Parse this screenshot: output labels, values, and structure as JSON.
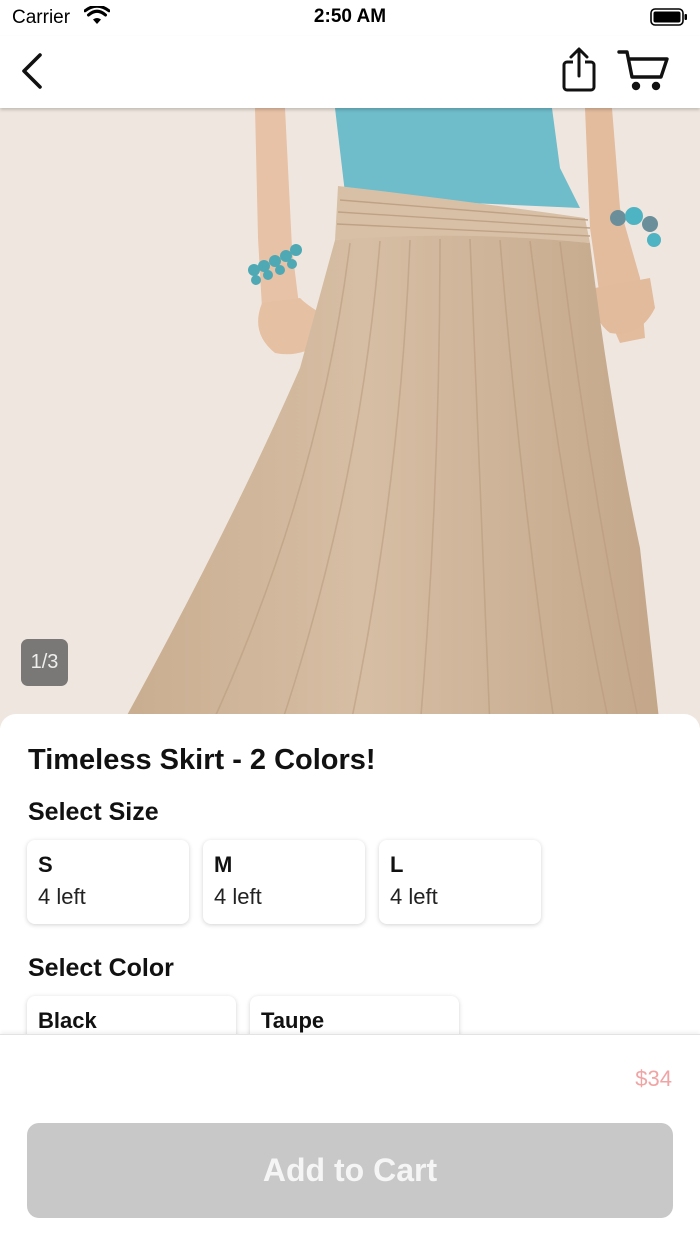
{
  "status_bar": {
    "carrier": "Carrier",
    "time": "2:50 AM",
    "wifi_icon": "wifi-icon",
    "battery_icon": "battery-icon"
  },
  "nav": {
    "back_icon": "chevron-left-icon",
    "share_icon": "share-icon",
    "cart_icon": "cart-icon"
  },
  "product": {
    "image_counter": "1/3",
    "title": "Timeless Skirt - 2 Colors!",
    "size_heading": "Select Size",
    "sizes": [
      {
        "name": "S",
        "stock": "4 left"
      },
      {
        "name": "M",
        "stock": "4 left"
      },
      {
        "name": "L",
        "stock": "4 left"
      }
    ],
    "color_heading": "Select Color",
    "colors": [
      {
        "name": "Black"
      },
      {
        "name": "Taupe"
      }
    ]
  },
  "footer": {
    "price": "$34",
    "add_to_cart_label": "Add to Cart"
  },
  "colors": {
    "skirt": "#d2b79c",
    "top": "#6fbccb",
    "backdrop": "#efe7df",
    "price": "#f0a4a4",
    "button_disabled": "#c8c8c8"
  }
}
